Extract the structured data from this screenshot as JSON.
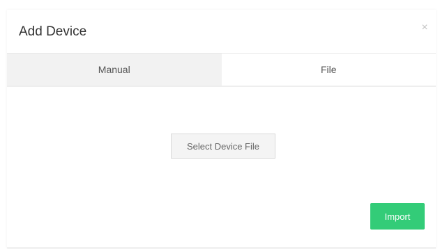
{
  "dialog": {
    "title": "Add Device",
    "close_icon": "close-icon",
    "close_glyph": "×"
  },
  "tabs": [
    {
      "label": "Manual",
      "active": false
    },
    {
      "label": "File",
      "active": true
    }
  ],
  "file_panel": {
    "select_button_label": "Select Device File"
  },
  "footer": {
    "import_label": "Import"
  },
  "colors": {
    "accent": "#33cc78",
    "inactive_tab_bg": "#f2f2f2",
    "title_text": "#333333"
  }
}
